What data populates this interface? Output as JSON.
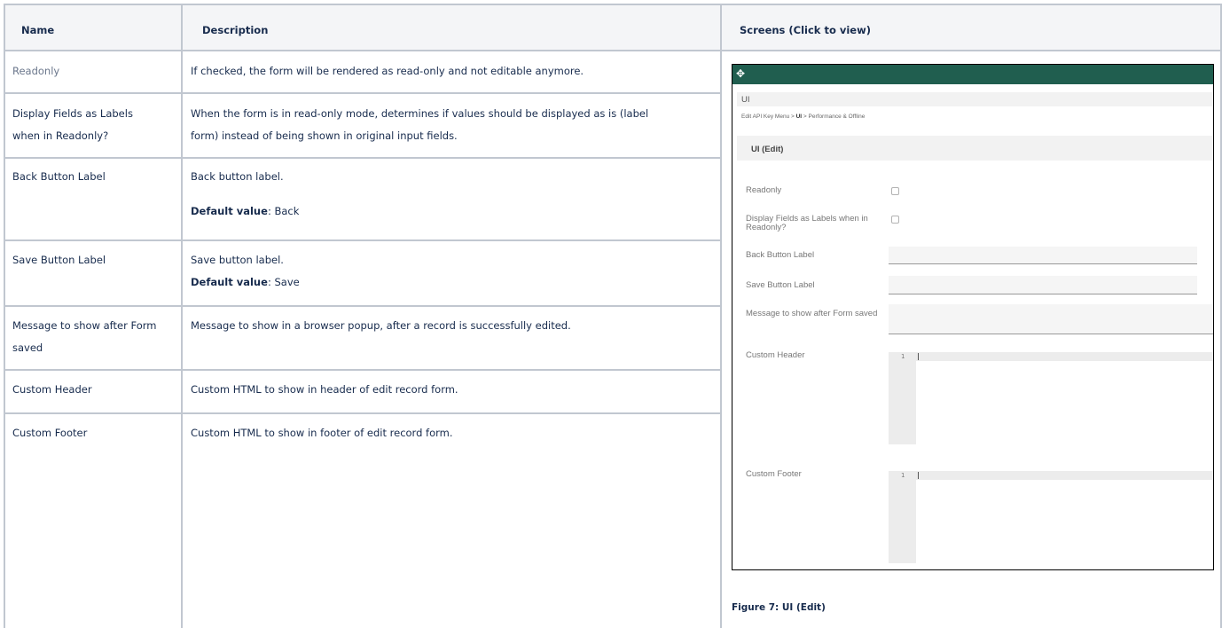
{
  "table": {
    "headers": {
      "name": "Name",
      "description": "Description",
      "screens": "Screens (Click to view)"
    },
    "rows": [
      {
        "name": "Readonly",
        "desc1": "If checked, the form will be rendered as read-only and not editable anymore."
      },
      {
        "name_l1": "Display Fields as Labels",
        "name_l2": "when in Readonly?",
        "desc1": "When the form is in read-only mode, determines if values should be displayed as is (label",
        "desc2": "form) instead of being shown in original input fields."
      },
      {
        "name": "Back Button Label",
        "desc1": "Back button label.",
        "default_key": "Default value",
        "default_val": ": Back"
      },
      {
        "name": "Save Button Label",
        "desc1": "Save button label.",
        "default_key": "Default value",
        "default_val": ": Save"
      },
      {
        "name_l1": "Message to show after Form",
        "name_l2": "saved",
        "desc1": "Message to show in a browser popup, after a record is successfully edited."
      },
      {
        "name": "Custom Header",
        "desc1": "Custom HTML to show in header of edit record form."
      },
      {
        "name": "Custom Footer",
        "desc1": "Custom HTML to show in footer of edit record form."
      }
    ]
  },
  "screenshot": {
    "bar_color": "#205e4f",
    "move_icon": "move-arrows-icon",
    "section_title": "UI",
    "breadcrumb_prefix": "Edit API Key Menu > ",
    "breadcrumb_current": "UI",
    "breadcrumb_suffix": " > Performance & Offline",
    "form_title": "UI (Edit)",
    "fields": {
      "readonly": "Readonly",
      "display_labels": "Display Fields as Labels when in Readonly?",
      "back_label": "Back Button Label",
      "save_label": "Save Button Label",
      "message": "Message to show after Form saved",
      "custom_header": "Custom Header",
      "custom_footer": "Custom Footer"
    },
    "line_number": "1"
  },
  "caption": "Figure 7: UI (Edit)"
}
